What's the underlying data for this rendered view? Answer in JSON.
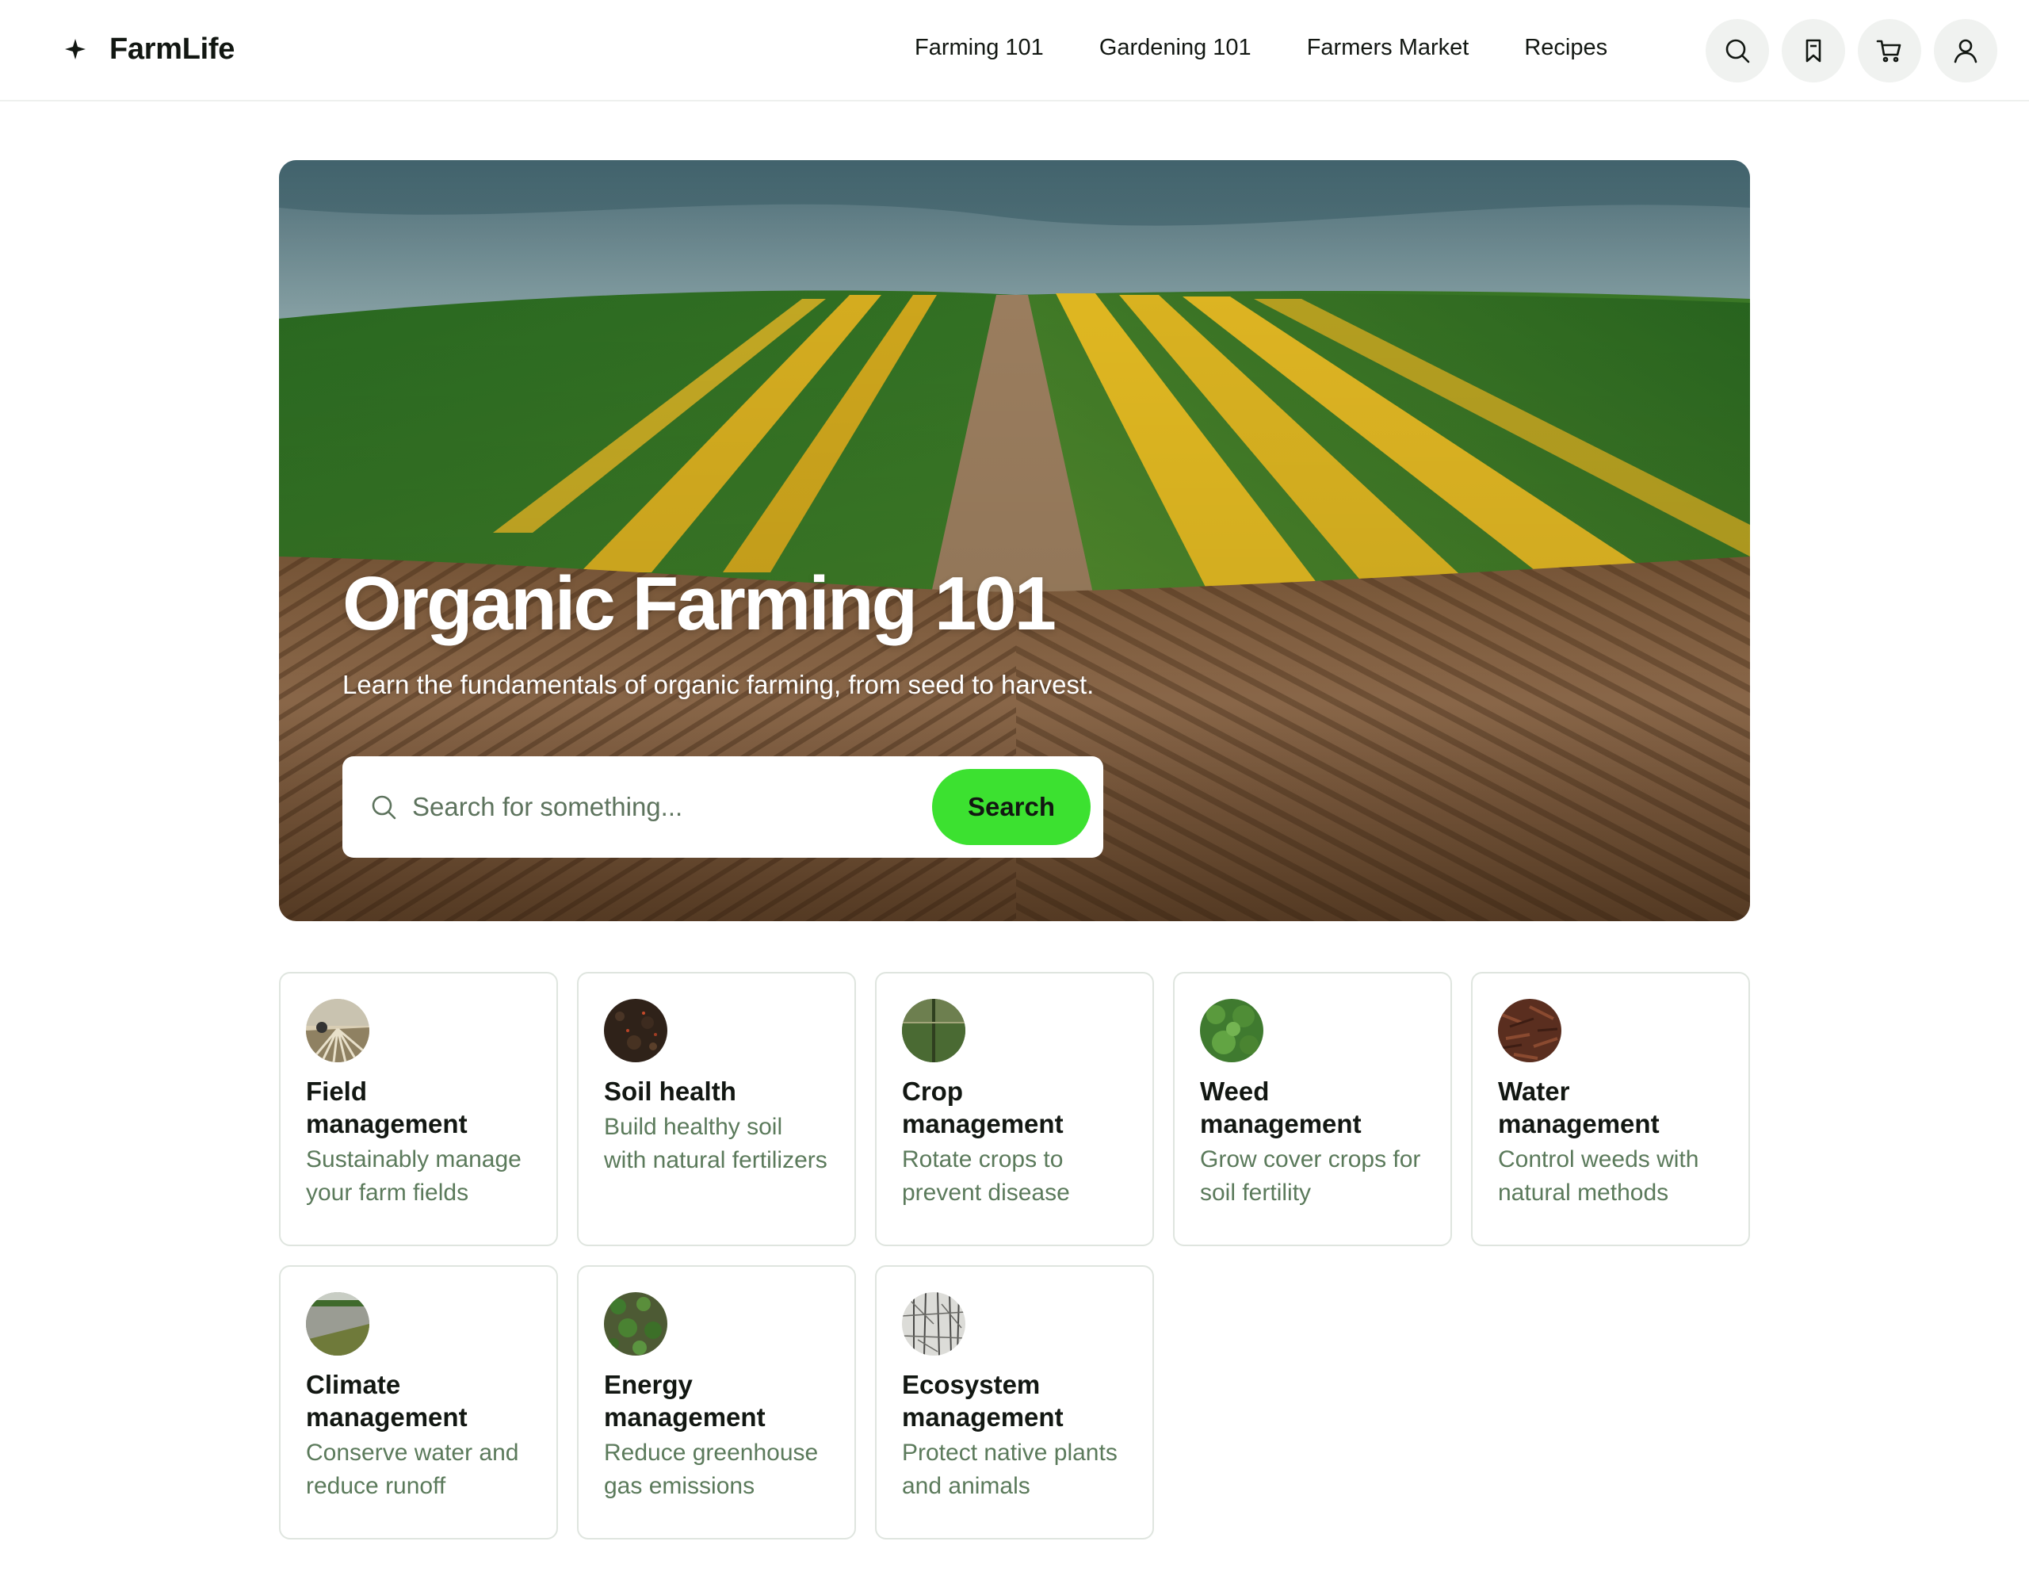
{
  "header": {
    "brand": "FarmLife",
    "nav": [
      "Farming 101",
      "Gardening 101",
      "Farmers Market",
      "Recipes"
    ],
    "icon_buttons": [
      "search-icon",
      "bookmark-icon",
      "cart-icon",
      "user-icon"
    ]
  },
  "hero": {
    "title": "Organic Farming 101",
    "subtitle": "Learn the fundamentals of organic farming, from seed to harvest.",
    "search_placeholder": "Search for something...",
    "search_button": "Search"
  },
  "cards": [
    {
      "title": "Field management",
      "desc": "Sustainably manage your farm fields",
      "thumb": "field-thumbnail"
    },
    {
      "title": "Soil health",
      "desc": "Build healthy soil with natural fertilizers",
      "thumb": "soil-thumbnail"
    },
    {
      "title": "Crop management",
      "desc": "Rotate crops to prevent disease",
      "thumb": "crop-thumbnail"
    },
    {
      "title": "Weed management",
      "desc": "Grow cover crops for soil fertility",
      "thumb": "weed-thumbnail"
    },
    {
      "title": "Water management",
      "desc": "Control weeds with natural methods",
      "thumb": "water-thumbnail"
    },
    {
      "title": "Climate management",
      "desc": "Conserve water and reduce runoff",
      "thumb": "climate-thumbnail"
    },
    {
      "title": "Energy management",
      "desc": "Reduce greenhouse gas emissions",
      "thumb": "energy-thumbnail"
    },
    {
      "title": "Ecosystem management",
      "desc": "Protect native plants and animals",
      "thumb": "ecosystem-thumbnail"
    }
  ],
  "colors": {
    "accent": "#3ce130",
    "muted_text": "#5b7a5b",
    "border": "#dfe5df"
  }
}
